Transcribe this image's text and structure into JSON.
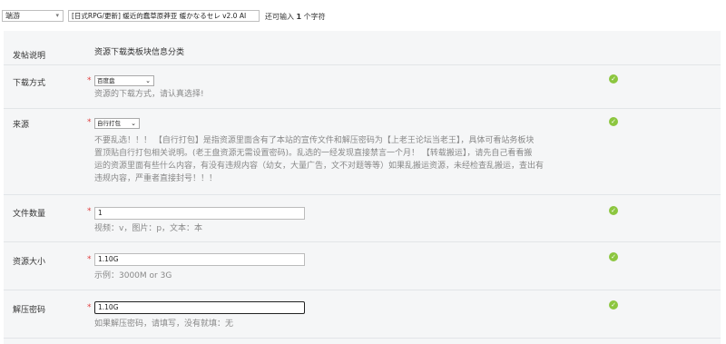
{
  "topbar": {
    "category_value": "端游",
    "title_value": "[日式RPG/更新] 缓近的蠢草原莽亚 缓かなるセレ v2.0 AI",
    "remain_prefix": "还可输入",
    "remain_count": "1",
    "remain_suffix": "个字符"
  },
  "header": {
    "label": "发帖说明",
    "text": "资源下载类板块信息分类"
  },
  "download": {
    "label": "下载方式",
    "selected": "百度盘",
    "help": "资源的下载方式，请认真选择!"
  },
  "source": {
    "label": "来源",
    "selected": "自行打包",
    "help": [
      "不要乱选！！！ 【自行打包】是指资源里面含有了本站的宣传文件和解压密码为【上老王论坛当老王】，具体可看站务板块",
      "置顶贴自行打包相关说明。(老王盘资源无需设置密码)。乱选的一经发现直接禁言一个月！ 【转载搬运】，请先自己看看搬",
      "运的资源里面有些什么内容，有没有违规内容（幼女，大量广告，文不对题等等）如果乱搬运资源，未经检查乱搬运，查出有",
      "违规内容，严重者直接封号！！！"
    ]
  },
  "file_count": {
    "label": "文件数量",
    "value": "1",
    "help": "视频：v，图片：p，文本：本"
  },
  "size": {
    "label": "资源大小",
    "value": "1.10G",
    "help": "示例：3000M or 3G"
  },
  "password": {
    "label": "解压密码",
    "value": "1.10G",
    "help": "如果解压密码，请填写，没有就填：无"
  },
  "required_mark": "*",
  "status_icon": "check-circle-icon",
  "colors": {
    "check": "#8cc63f",
    "required": "#e04040",
    "panel": "#f5f6f7"
  }
}
